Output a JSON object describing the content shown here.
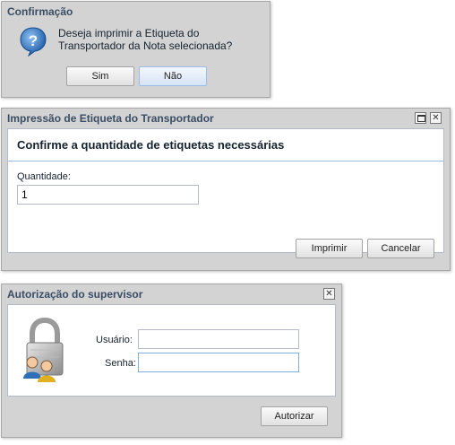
{
  "confirm": {
    "title": "Confirmação",
    "message_line1": "Deseja imprimir a Etiqueta do",
    "message_line2": "Transportador da Nota selecionada?",
    "yes": "Sim",
    "no": "Não"
  },
  "label_dialog": {
    "title": "Impressão de Etiqueta do Transportador",
    "heading": "Confirme a quantidade de etiquetas necessárias",
    "quantity_label": "Quantidade:",
    "quantity_value": "1",
    "print": "Imprimir",
    "cancel": "Cancelar"
  },
  "auth_dialog": {
    "title": "Autorização do supervisor",
    "user_label": "Usuário:",
    "user_value": "",
    "password_label": "Senha:",
    "password_value": "",
    "authorize": "Autorizar"
  }
}
